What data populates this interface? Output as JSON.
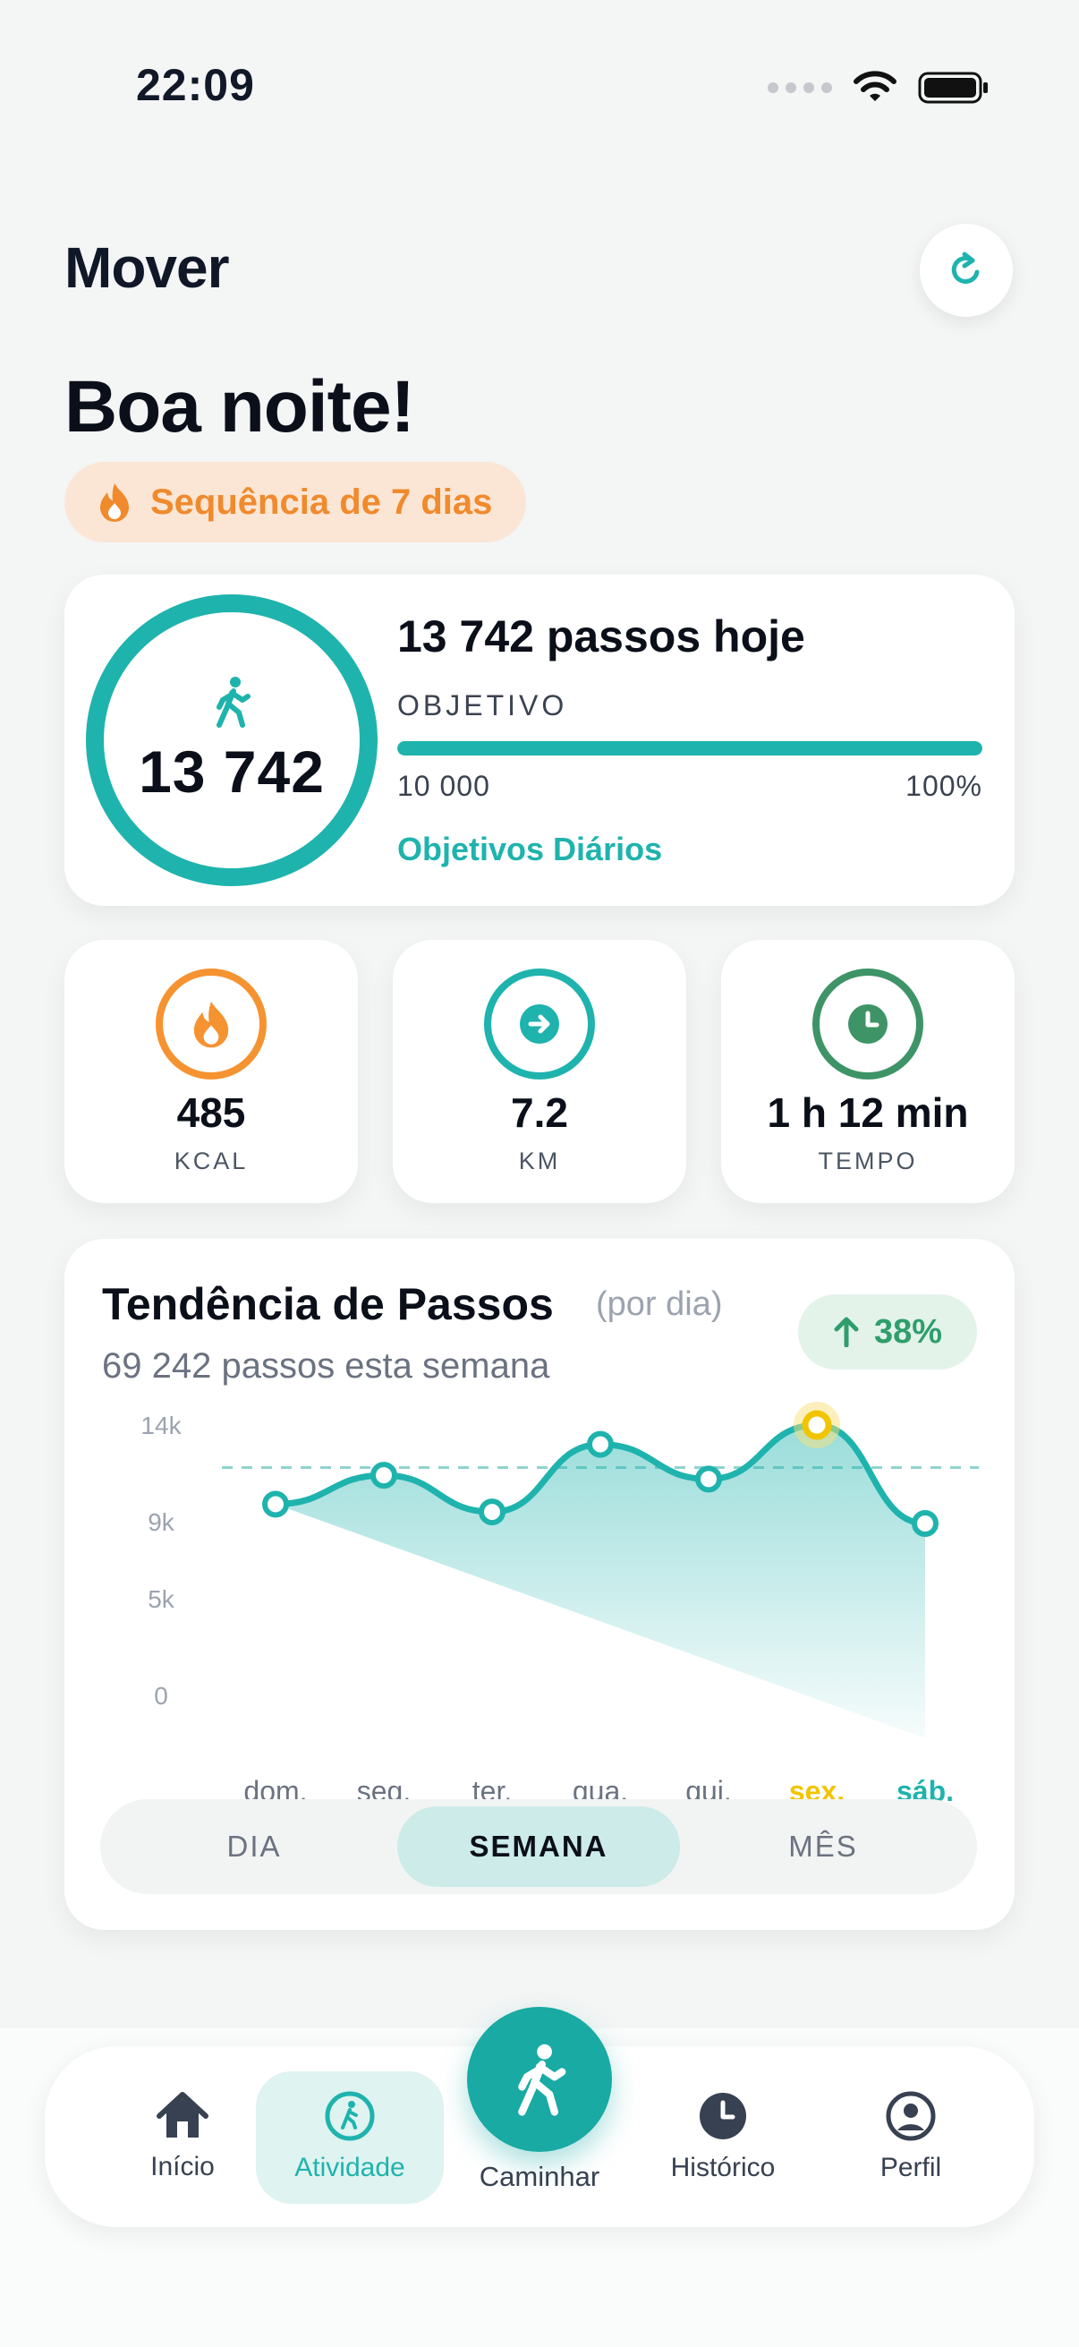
{
  "status": {
    "time": "22:09"
  },
  "header": {
    "title": "Mover"
  },
  "greeting": "Boa noite!",
  "streak": {
    "label": "Sequência de 7 dias"
  },
  "steps": {
    "value": "13 742",
    "headline": "13 742 passos hoje",
    "goal_label": "OBJETIVO",
    "goal_target": "10 000",
    "goal_percent": "100%",
    "goal_progress": 1.0,
    "link": "Objetivos Diários"
  },
  "metrics": [
    {
      "value": "485",
      "label": "KCAL",
      "icon": "flame-icon",
      "color": "#f59331"
    },
    {
      "value": "7.2",
      "label": "KM",
      "icon": "arrow-right-icon",
      "color": "#1fb3ad"
    },
    {
      "value": "1 h 12 min",
      "label": "TEMPO",
      "icon": "clock-icon",
      "color": "#3e9466"
    }
  ],
  "trend": {
    "title": "Tendência de Passos",
    "subtitle": "(por dia)",
    "week_total": "69 242 passos esta semana",
    "change": "38%"
  },
  "chart_data": {
    "type": "area",
    "categories": [
      "dom.",
      "seg.",
      "ter.",
      "qua.",
      "qui.",
      "sex.",
      "sáb."
    ],
    "values": [
      9900,
      11400,
      9500,
      13000,
      11200,
      14000,
      8900
    ],
    "yticks": [
      "14k",
      "9k",
      "5k",
      "0"
    ],
    "ylim": [
      0,
      14000
    ],
    "goal_line": 11800,
    "highlight_index": 5,
    "current_index": 6,
    "colors": {
      "line": "#1fb3ad",
      "highlight": "#f2c400",
      "today": "#1fb3ad"
    }
  },
  "range_tabs": [
    {
      "label": "DIA",
      "active": false
    },
    {
      "label": "SEMANA",
      "active": true
    },
    {
      "label": "MÊS",
      "active": false
    }
  ],
  "nav": {
    "home": "Início",
    "activity": "Atividade",
    "walk": "Caminhar",
    "history": "Histórico",
    "profile": "Perfil"
  },
  "colors": {
    "accent": "#1fb3ad",
    "streak": "#f08a2c",
    "positive": "#2f9e6b"
  }
}
